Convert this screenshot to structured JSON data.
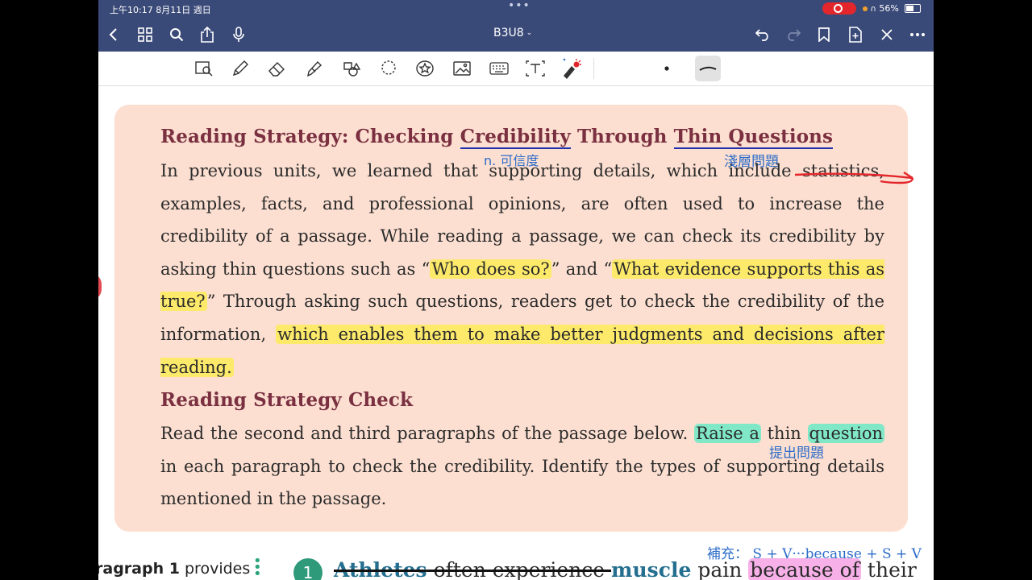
{
  "status_bar": {
    "time": "上午10:17  8月11日 週日",
    "dots": "•••",
    "battery_text": "56%",
    "battery_level": 0.56
  },
  "nav": {
    "title": "B3U8"
  },
  "card": {
    "heading_1": {
      "part_a": "Reading Strategy: Checking ",
      "word_1": "Credibility",
      "part_b": " Through ",
      "word_2": "Thin Questions"
    },
    "para_1": {
      "s1": "In previous units, we learned that supporting details, which include ",
      "s2": "statistics,",
      "s3": " examples, facts, and professional opinions, are often used to increase the credibility of a passage. While reading a passage, we can check its credibility by asking thin questions such as “",
      "h1": "Who does so?",
      "s4": "” and “",
      "h2": "What evidence supports this as true?",
      "s5": "” Through asking such questions, readers get to check the credibility of the information, ",
      "h3": "which enables them to make better judgments and decisions after reading.",
      "s6": ""
    },
    "heading_2": "Reading Strategy Check",
    "para_2": {
      "s1": "Read the second and third paragraphs of the passage below. ",
      "h1": "Raise a",
      "s2": " thin ",
      "h2": "question",
      "s3": " in each paragraph to check the credibility. Identify the types of supporting details mentioned in the passage."
    }
  },
  "annotations": {
    "note_credibility": "n. 可信度",
    "note_thin_questions": "淺層問題",
    "note_raise": "提出問題",
    "note_supplement": "補充： S + V···because + S + V"
  },
  "bottom": {
    "left_bold": "ragraph 1",
    "left_rest": " provides",
    "number": "1",
    "w1": "Athletes",
    "w2": " often experience ",
    "w3": "muscle",
    "w4": " pain ",
    "w5": "because of",
    "w6": " their"
  },
  "colors": {
    "bar": "#3a4a78",
    "card_bg": "#fcdfd1",
    "heading": "#7a3040",
    "highlight_yellow": "#fde96a",
    "highlight_green": "#80e8c6",
    "highlight_pink": "#f7b0e8",
    "annotation_blue": "#2c6cc8",
    "pen_red": "#e3262b"
  },
  "icons": {
    "nav": [
      "back-icon",
      "grid-icon",
      "search-icon",
      "share-icon",
      "mic-icon",
      "undo-icon",
      "redo-icon",
      "bookmark-icon",
      "add-page-icon",
      "close-icon",
      "more-icon"
    ],
    "tools": [
      "zoom-view-icon",
      "pen-icon",
      "eraser-icon",
      "highlighter-icon",
      "shapes-icon",
      "lasso-icon",
      "sticker-icon",
      "image-icon",
      "keyboard-icon",
      "text-box-icon",
      "laser-pointer-icon",
      "pen-size-dot-icon",
      "stroke-style-icon"
    ]
  }
}
